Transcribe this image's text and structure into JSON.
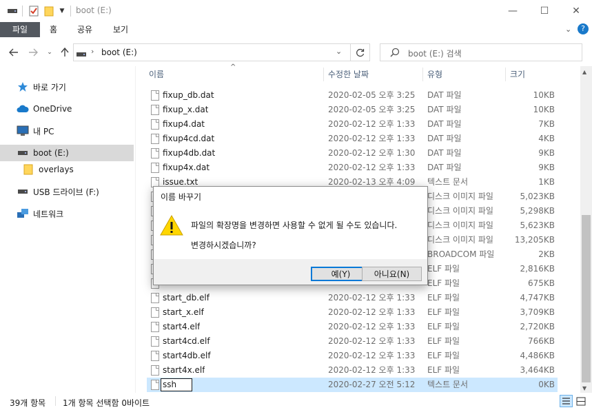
{
  "window": {
    "title": "boot (E:)",
    "minimize": "—",
    "maximize": "☐",
    "close": "✕"
  },
  "ribbon": {
    "tabs": [
      "파일",
      "홈",
      "공유",
      "보기"
    ]
  },
  "address": {
    "path": "boot (E:)",
    "search_placeholder": "boot (E:) 검색"
  },
  "sidebar": {
    "items": [
      {
        "label": "바로 가기",
        "icon": "star-icon"
      },
      {
        "label": "OneDrive",
        "icon": "cloud-icon"
      },
      {
        "label": "내 PC",
        "icon": "pc-icon"
      },
      {
        "label": "boot (E:)",
        "icon": "drive-icon"
      },
      {
        "label": "overlays",
        "icon": "folder-icon"
      },
      {
        "label": "USB 드라이브 (F:)",
        "icon": "drive-icon"
      },
      {
        "label": "네트워크",
        "icon": "network-icon"
      }
    ]
  },
  "columns": {
    "name": "이름",
    "date": "수정한 날짜",
    "type": "유형",
    "size": "크기"
  },
  "files": [
    {
      "name": "fixup_db.dat",
      "date": "2020-02-05 오후 3:25",
      "type": "DAT 파일",
      "size": "10KB"
    },
    {
      "name": "fixup_x.dat",
      "date": "2020-02-05 오후 3:25",
      "type": "DAT 파일",
      "size": "10KB"
    },
    {
      "name": "fixup4.dat",
      "date": "2020-02-12 오후 1:33",
      "type": "DAT 파일",
      "size": "7KB"
    },
    {
      "name": "fixup4cd.dat",
      "date": "2020-02-12 오후 1:33",
      "type": "DAT 파일",
      "size": "4KB"
    },
    {
      "name": "fixup4db.dat",
      "date": "2020-02-12 오후 1:30",
      "type": "DAT 파일",
      "size": "9KB"
    },
    {
      "name": "fixup4x.dat",
      "date": "2020-02-12 오후 1:33",
      "type": "DAT 파일",
      "size": "9KB"
    },
    {
      "name": "issue.txt",
      "date": "2020-02-13 오후 4:09",
      "type": "텍스트 문서",
      "size": "1KB"
    },
    {
      "name": "",
      "date": "",
      "type": "디스크 이미지 파일",
      "size": "5,023KB"
    },
    {
      "name": "",
      "date": "",
      "type": "디스크 이미지 파일",
      "size": "5,298KB"
    },
    {
      "name": "",
      "date": "",
      "type": "디스크 이미지 파일",
      "size": "5,623KB"
    },
    {
      "name": "",
      "date": "",
      "type": "디스크 이미지 파일",
      "size": "13,205KB"
    },
    {
      "name": "",
      "date": "",
      "type": "BROADCOM 파일",
      "size": "2KB"
    },
    {
      "name": "",
      "date": "",
      "type": "ELF 파일",
      "size": "2,816KB"
    },
    {
      "name": "",
      "date": "",
      "type": "ELF 파일",
      "size": "675KB"
    },
    {
      "name": "start_db.elf",
      "date": "2020-02-12 오후 1:33",
      "type": "ELF 파일",
      "size": "4,747KB"
    },
    {
      "name": "start_x.elf",
      "date": "2020-02-12 오후 1:33",
      "type": "ELF 파일",
      "size": "3,709KB"
    },
    {
      "name": "start4.elf",
      "date": "2020-02-12 오후 1:33",
      "type": "ELF 파일",
      "size": "2,720KB"
    },
    {
      "name": "start4cd.elf",
      "date": "2020-02-12 오후 1:33",
      "type": "ELF 파일",
      "size": "766KB"
    },
    {
      "name": "start4db.elf",
      "date": "2020-02-12 오후 1:33",
      "type": "ELF 파일",
      "size": "4,486KB"
    },
    {
      "name": "start4x.elf",
      "date": "2020-02-12 오후 1:33",
      "type": "ELF 파일",
      "size": "3,464KB"
    },
    {
      "name": "ssh",
      "date": "2020-02-27 오전 5:12",
      "type": "텍스트 문서",
      "size": "0KB"
    }
  ],
  "status": {
    "count": "39개 항목",
    "selection": "1개 항목 선택함 0바이트"
  },
  "dialog": {
    "title": "이름 바꾸기",
    "message": "파일의 확장명을 변경하면 사용할 수 없게 될 수도 있습니다.",
    "question": "변경하시겠습니까?",
    "yes_label": "예(Y)",
    "no_label": "아니요(N)"
  }
}
